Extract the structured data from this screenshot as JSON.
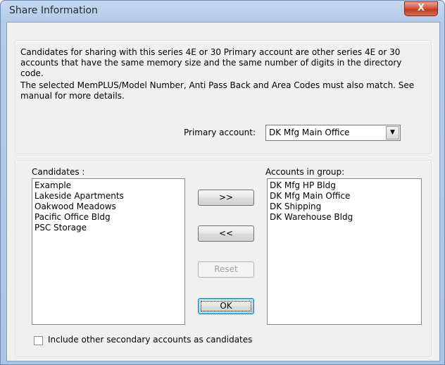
{
  "window": {
    "title": "Share Information",
    "close_label": "X"
  },
  "description": {
    "para1": "Candidates for sharing with this series 4E or 30 Primary account are other series 4E or 30 accounts that have the same memory size and the same number of digits in the directory code.",
    "para2": "The selected MemPLUS/Model Number, Anti Pass Back and Area Codes must also match.  See manual for more details."
  },
  "primary": {
    "label": "Primary account:",
    "value": "DK Mfg Main Office",
    "arrow": "▼"
  },
  "candidates": {
    "label": "Candidates :",
    "items": [
      "Example",
      "Lakeside Apartments",
      "Oakwood Meadows",
      "Pacific Office Bldg",
      "PSC Storage"
    ]
  },
  "group": {
    "label": "Accounts in group:",
    "items": [
      "DK Mfg HP Bldg",
      "DK Mfg Main Office",
      "DK Shipping",
      "DK Warehouse Bldg"
    ]
  },
  "buttons": {
    "add": ">>",
    "remove": "<<",
    "reset": "Reset",
    "ok": "OK"
  },
  "include_secondary": {
    "label": "Include other secondary accounts as candidates",
    "checked": false
  }
}
